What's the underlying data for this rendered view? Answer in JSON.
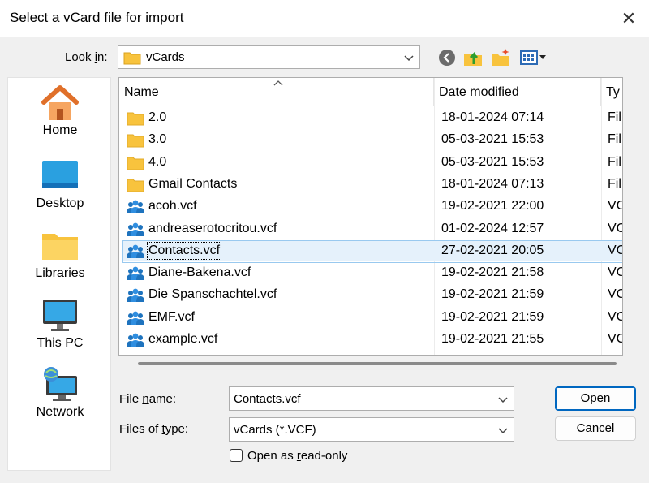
{
  "dialog": {
    "title": "Select a vCard file for import"
  },
  "look_in": {
    "label_pre": "Look ",
    "label_u": "i",
    "label_post": "n:",
    "value": "vCards"
  },
  "places": [
    {
      "label": "Home",
      "icon": "home-icon"
    },
    {
      "label": "Desktop",
      "icon": "desktop-icon"
    },
    {
      "label": "Libraries",
      "icon": "libraries-icon"
    },
    {
      "label": "This PC",
      "icon": "this-pc-icon"
    },
    {
      "label": "Network",
      "icon": "network-icon"
    }
  ],
  "columns": {
    "name": "Name",
    "date": "Date modified",
    "type": "Ty"
  },
  "files": [
    {
      "name": "2.0",
      "date": "18-01-2024 07:14",
      "type": "Fil",
      "kind": "folder"
    },
    {
      "name": "3.0",
      "date": "05-03-2021 15:53",
      "type": "Fil",
      "kind": "folder"
    },
    {
      "name": "4.0",
      "date": "05-03-2021 15:53",
      "type": "Fil",
      "kind": "folder"
    },
    {
      "name": "Gmail Contacts",
      "date": "18-01-2024 07:13",
      "type": "Fil",
      "kind": "folder"
    },
    {
      "name": "acoh.vcf",
      "date": "19-02-2021 22:00",
      "type": "VC",
      "kind": "vcard"
    },
    {
      "name": "andreaserotocritou.vcf",
      "date": "01-02-2024 12:57",
      "type": "VC",
      "kind": "vcard"
    },
    {
      "name": "Contacts.vcf",
      "date": "27-02-2021 20:05",
      "type": "VC",
      "kind": "vcard",
      "selected": true
    },
    {
      "name": "Diane-Bakena.vcf",
      "date": "19-02-2021 21:58",
      "type": "VC",
      "kind": "vcard"
    },
    {
      "name": "Die Spanschachtel.vcf",
      "date": "19-02-2021 21:59",
      "type": "VC",
      "kind": "vcard"
    },
    {
      "name": "EMF.vcf",
      "date": "19-02-2021 21:59",
      "type": "VC",
      "kind": "vcard"
    },
    {
      "name": "example.vcf",
      "date": "19-02-2021 21:55",
      "type": "VC",
      "kind": "vcard"
    }
  ],
  "file_name": {
    "label_pre": "File ",
    "label_u": "n",
    "label_post": "ame:",
    "value": "Contacts.vcf"
  },
  "file_type": {
    "label_pre": "Files of ",
    "label_u": "t",
    "label_post": "ype:",
    "value": "vCards (*.VCF)"
  },
  "read_only": {
    "label_pre": "Open as ",
    "label_u": "r",
    "label_post": "ead-only"
  },
  "buttons": {
    "open_u": "O",
    "open_rest": "pen",
    "cancel": "Cancel"
  },
  "colors": {
    "folder": "#f8c33d",
    "vcard": "#1e73be",
    "accent": "#0067c0",
    "selection": "#e5f1fb"
  }
}
